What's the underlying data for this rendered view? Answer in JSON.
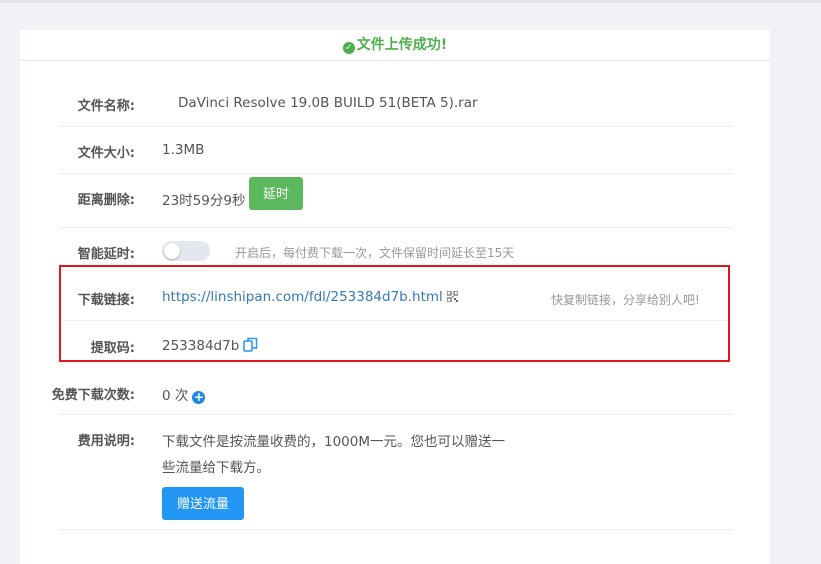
{
  "header": {
    "success_text": "文件上传成功!"
  },
  "file": {
    "name_label": "文件名称:",
    "name_value": "DaVinci Resolve 19.0B BUILD 51(BETA 5).rar",
    "size_label": "文件大小:",
    "size_value": "1.3MB"
  },
  "delete": {
    "label": "距离删除:",
    "countdown": "23时59分9秒",
    "extend_button": "延时"
  },
  "smart_delay": {
    "label": "智能延时:",
    "enabled": false,
    "hint": "开启后，每付费下载一次，文件保留时间延长至15天"
  },
  "download_link": {
    "label": "下载链接:",
    "url": "https://linshipan.com/fdl/253384d7b.html",
    "hint": "快复制链接，分享给别人吧!"
  },
  "extract_code": {
    "label": "提取码:",
    "value": "253384d7b"
  },
  "free_downloads": {
    "label": "免费下载次数:",
    "value": "0 次"
  },
  "fee": {
    "label": "费用说明:",
    "line1": "下载文件是按流量收费的，1000M一元。您也可以赠送一",
    "line2": "些流量给下载方。",
    "gift_button": "赠送流量"
  },
  "colors": {
    "success": "#4cae4c",
    "green_button": "#5cb85c",
    "blue_button": "#2196f3",
    "link": "#337ab7",
    "highlight_box": "#e3161c"
  }
}
